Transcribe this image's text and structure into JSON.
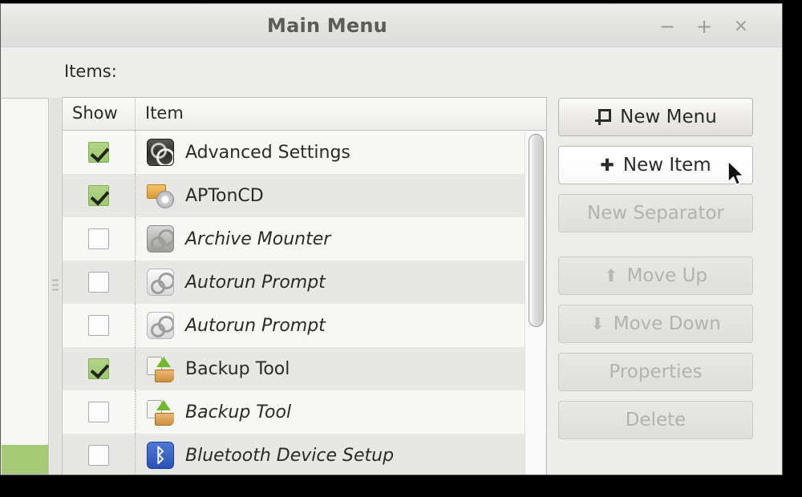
{
  "window": {
    "title": "Main Menu",
    "controls": {
      "minimize": "−",
      "maximize": "+",
      "close": "×"
    }
  },
  "main": {
    "items_label": "Items:",
    "columns": {
      "show": "Show",
      "item": "Item"
    },
    "rows": [
      {
        "label": "Advanced Settings",
        "checked": true,
        "icon": "advanced-settings-icon"
      },
      {
        "label": "APTonCD",
        "checked": true,
        "icon": "aptoncd-icon"
      },
      {
        "label": "Archive Mounter",
        "checked": false,
        "icon": "archive-mounter-icon"
      },
      {
        "label": "Autorun Prompt",
        "checked": false,
        "icon": "autorun-prompt-icon"
      },
      {
        "label": "Autorun Prompt",
        "checked": false,
        "icon": "autorun-prompt-icon"
      },
      {
        "label": "Backup Tool",
        "checked": true,
        "icon": "backup-tool-icon"
      },
      {
        "label": "Backup Tool",
        "checked": false,
        "icon": "backup-tool-icon"
      },
      {
        "label": "Bluetooth Device Setup",
        "checked": false,
        "icon": "bluetooth-icon"
      }
    ]
  },
  "buttons": {
    "new_menu": "New Menu",
    "new_item": "New Item",
    "new_separator": "New Separator",
    "move_up": "Move Up",
    "move_down": "Move Down",
    "properties": "Properties",
    "delete": "Delete",
    "glyphs": {
      "new_item_plus": "✚",
      "move_up_arrow": "⬆",
      "move_down_arrow": "⬇"
    }
  },
  "icons": {
    "bluetooth_glyph": "ᛒ"
  },
  "colors": {
    "checkbox_on": "#9cc96c",
    "selection_green": "#a5ca76",
    "window_bg": "#ededeb",
    "bluetooth_blue": "#2b53b8"
  }
}
